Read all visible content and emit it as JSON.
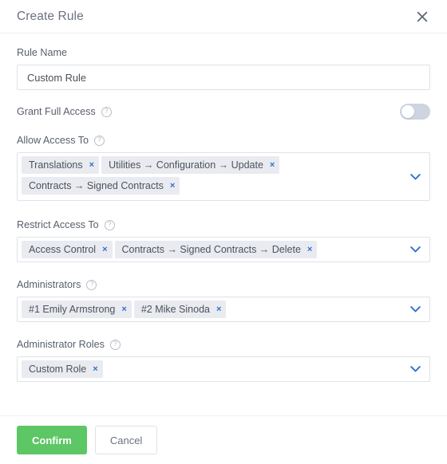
{
  "dialog": {
    "title": "Create Rule",
    "close_icon": "close-icon"
  },
  "form": {
    "rule_name": {
      "label": "Rule Name",
      "value": "Custom Rule",
      "placeholder": "Rule Name"
    },
    "grant_full_access": {
      "label": "Grant Full Access",
      "help_icon": "help-circle-icon",
      "enabled": false
    },
    "allow_access_to": {
      "label": "Allow Access To",
      "help_icon": "help-circle-icon",
      "chips": [
        "Translations",
        "Utilities → Configuration → Update",
        "Contracts → Signed Contracts"
      ],
      "remove_label": "×",
      "chevron_icon": "chevron-down-icon"
    },
    "restrict_access_to": {
      "label": "Restrict Access To",
      "help_icon": "help-circle-icon",
      "chips": [
        "Access Control",
        "Contracts → Signed Contracts → Delete"
      ],
      "remove_label": "×",
      "chevron_icon": "chevron-down-icon"
    },
    "administrators": {
      "label": "Administrators",
      "help_icon": "help-circle-icon",
      "chips": [
        "#1 Emily Armstrong",
        "#2 Mike Sinoda"
      ],
      "remove_label": "×",
      "chevron_icon": "chevron-down-icon"
    },
    "administrator_roles": {
      "label": "Administrator Roles",
      "help_icon": "help-circle-icon",
      "chips": [
        "Custom Role"
      ],
      "remove_label": "×",
      "chevron_icon": "chevron-down-icon"
    }
  },
  "footer": {
    "confirm_label": "Confirm",
    "cancel_label": "Cancel"
  },
  "colors": {
    "accent_blue": "#2f6fd0",
    "confirm_green": "#5cc764",
    "chip_bg": "#e9ebf0",
    "border": "#dfe2e7",
    "label_text": "#585f6b",
    "toggle_off": "#ced4e0"
  },
  "help_glyph": "?"
}
